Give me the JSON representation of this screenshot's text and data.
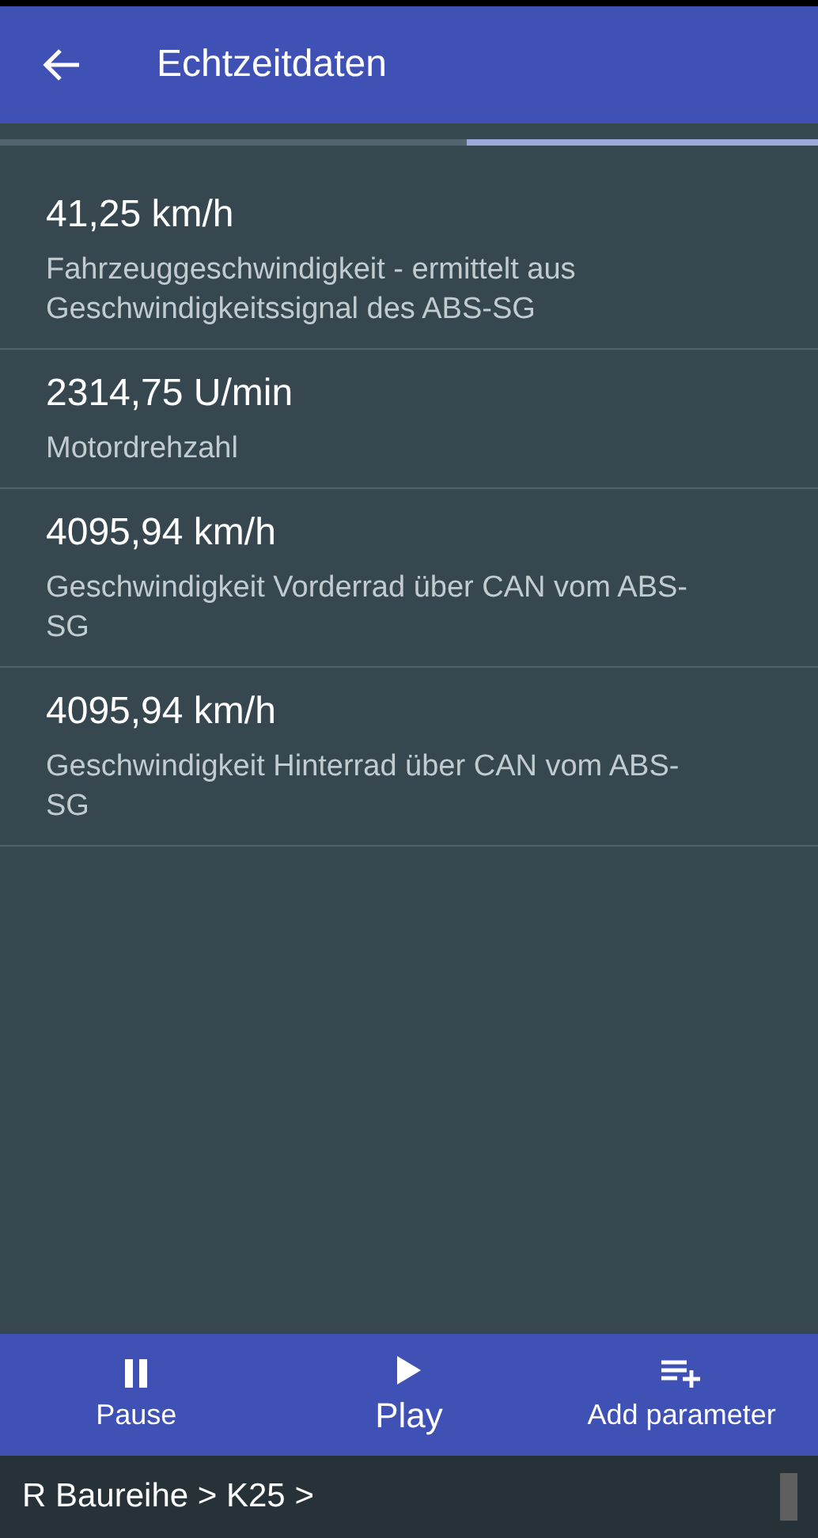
{
  "app_bar": {
    "title": "Echtzeitdaten"
  },
  "progress": {
    "level": 0.43
  },
  "readings": [
    {
      "value": "41,25 km/h",
      "description": "Fahrzeuggeschwindigkeit - ermittelt aus Geschwindigkeitssignal des ABS-SG"
    },
    {
      "value": "2314,75 U/min",
      "description": "Motordrehzahl"
    },
    {
      "value": "4095,94 km/h",
      "description": "Geschwindigkeit Vorderrad über CAN vom ABS-SG"
    },
    {
      "value": "4095,94 km/h",
      "description": "Geschwindigkeit Hinterrad über CAN vom ABS-SG"
    }
  ],
  "bottom_actions": [
    {
      "kind": "pause",
      "label": "Pause",
      "selected": false
    },
    {
      "kind": "play",
      "label": "Play",
      "selected": true
    },
    {
      "kind": "add",
      "label": "Add parameter",
      "selected": false
    }
  ],
  "breadcrumb": "R Baureihe > K25 >"
}
